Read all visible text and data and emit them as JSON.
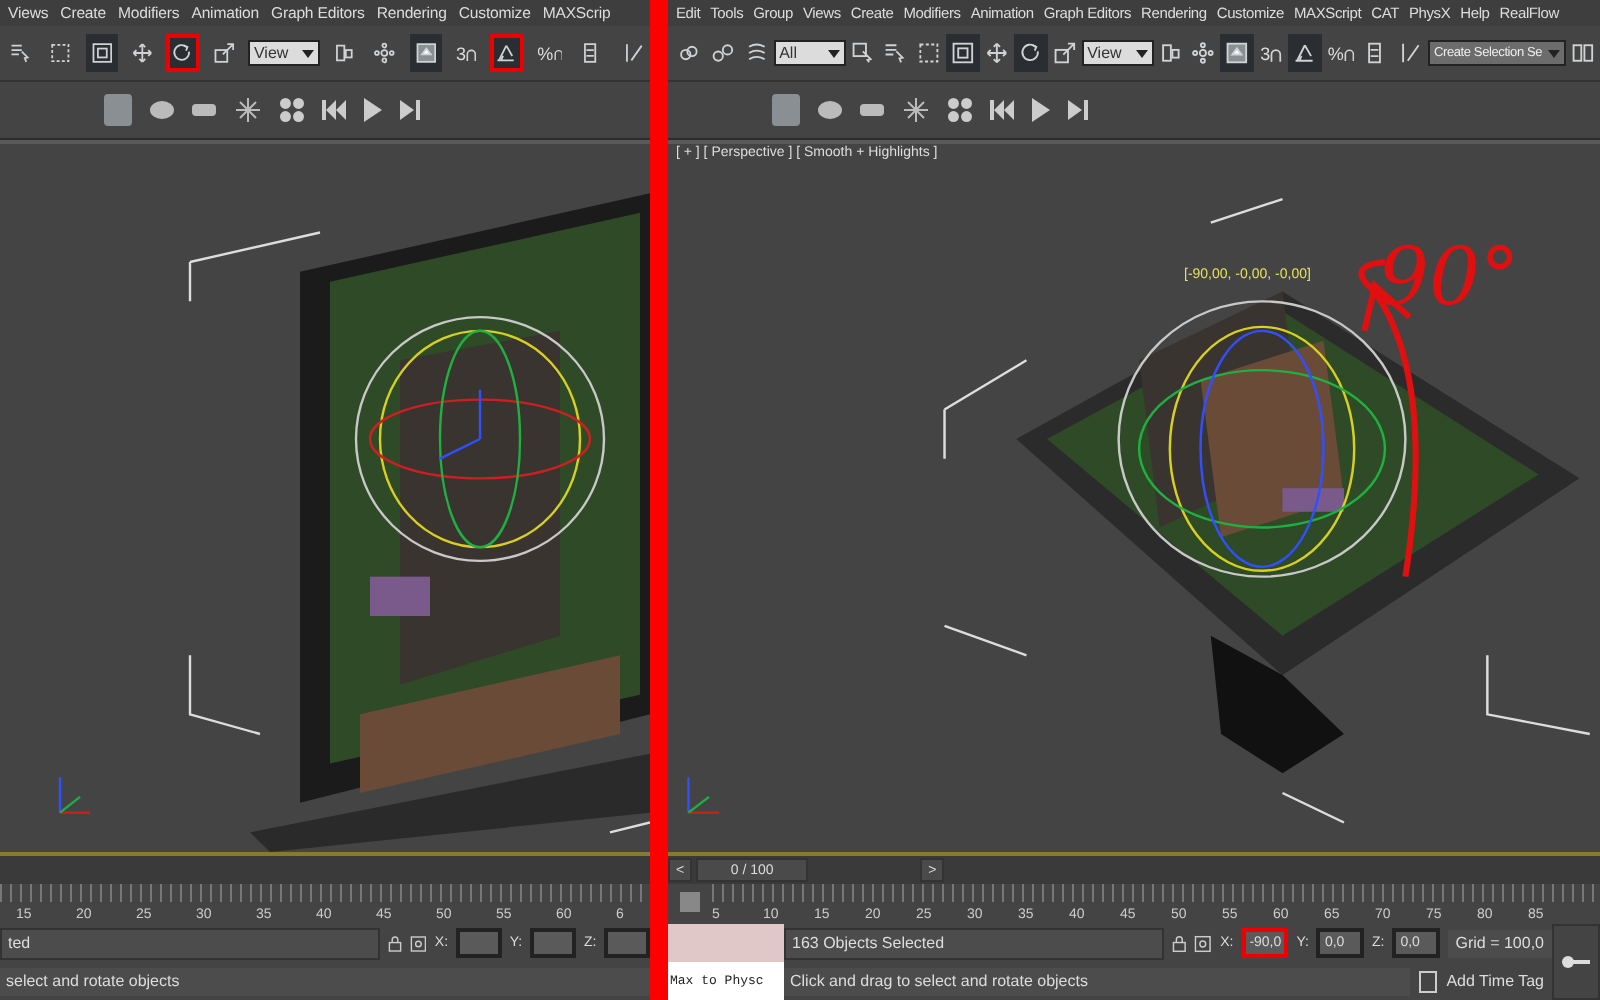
{
  "panels": [
    {
      "menu": [
        "Views",
        "Create",
        "Modifiers",
        "Animation",
        "Graph Editors",
        "Rendering",
        "Customize",
        "MAXScrip"
      ],
      "tools": [
        {
          "kind": "select-by-name",
          "circled": false,
          "selected": false
        },
        {
          "kind": "rect-region",
          "circled": false,
          "selected": false
        },
        {
          "kind": "window-crossing",
          "circled": false,
          "selected": true
        },
        {
          "kind": "move",
          "circled": false,
          "selected": false
        },
        {
          "kind": "rotate",
          "circled": true,
          "selected": true
        },
        {
          "kind": "scale",
          "circled": false,
          "selected": false
        },
        {
          "kind": "dropdown",
          "value": "View"
        },
        {
          "kind": "pivot",
          "circled": false,
          "selected": false
        },
        {
          "kind": "pivot-node",
          "circled": false,
          "selected": false
        },
        {
          "kind": "manipulate",
          "circled": false,
          "selected": true
        },
        {
          "kind": "snap",
          "label": "3",
          "circled": false,
          "selected": false
        },
        {
          "kind": "angle-snap",
          "circled": true,
          "selected": true
        },
        {
          "kind": "percent-snap",
          "label": "%",
          "circled": false,
          "selected": false
        },
        {
          "kind": "spinner-snap",
          "circled": false,
          "selected": false
        },
        {
          "kind": "edit-named",
          "circled": false,
          "selected": false
        }
      ],
      "ruler": [
        "15",
        "20",
        "25",
        "30",
        "35",
        "40",
        "45",
        "50",
        "55",
        "60",
        "6"
      ],
      "status": "ted",
      "coords": [
        {
          "label": "X:",
          "circled": false
        },
        {
          "label": "Y:",
          "circled": false
        },
        {
          "label": "Z:",
          "circled": false
        }
      ],
      "prompt": "select and rotate objects"
    },
    {
      "menu": [
        "Edit",
        "Tools",
        "Group",
        "Views",
        "Create",
        "Modifiers",
        "Animation",
        "Graph Editors",
        "Rendering",
        "Customize",
        "MAXScript",
        "CAT",
        "PhysX",
        "Help",
        "RealFlow"
      ],
      "tools": [
        {
          "kind": "link",
          "circled": false,
          "selected": false
        },
        {
          "kind": "unlink",
          "circled": false,
          "selected": false
        },
        {
          "kind": "bind",
          "circled": false,
          "selected": false
        },
        {
          "kind": "dropdown",
          "value": "All"
        },
        {
          "kind": "select",
          "circled": false,
          "selected": false
        },
        {
          "kind": "select-by-name",
          "circled": false,
          "selected": false
        },
        {
          "kind": "rect-region",
          "circled": false,
          "selected": false
        },
        {
          "kind": "window-crossing",
          "circled": false,
          "selected": true
        },
        {
          "kind": "move",
          "circled": false,
          "selected": false
        },
        {
          "kind": "rotate",
          "circled": false,
          "selected": true
        },
        {
          "kind": "scale",
          "circled": false,
          "selected": false
        },
        {
          "kind": "dropdown",
          "value": "View"
        },
        {
          "kind": "pivot",
          "circled": false,
          "selected": false
        },
        {
          "kind": "pivot-node",
          "circled": false,
          "selected": false
        },
        {
          "kind": "manipulate",
          "circled": false,
          "selected": true
        },
        {
          "kind": "snap",
          "label": "3",
          "circled": false,
          "selected": false
        },
        {
          "kind": "angle-snap",
          "circled": false,
          "selected": true
        },
        {
          "kind": "percent-snap",
          "label": "%",
          "circled": false,
          "selected": false
        },
        {
          "kind": "spinner-snap",
          "circled": false,
          "selected": false
        },
        {
          "kind": "edit-named",
          "circled": false,
          "selected": false
        },
        {
          "kind": "wide-dropdown",
          "value": "Create Selection Se"
        },
        {
          "kind": "mirror",
          "circled": false,
          "selected": false
        }
      ],
      "viewport_label": "[ + ] [ Perspective ] [ Smooth + Highlights ]",
      "gizmo_readout": "[-90,00, -0,00, -0,00]",
      "handwritten_note": "90°",
      "time_slider": {
        "prev": "<",
        "position": "0 / 100",
        "level": 0,
        "next": ">"
      },
      "ruler": [
        "5",
        "10",
        "15",
        "20",
        "25",
        "30",
        "35",
        "40",
        "45",
        "50",
        "55",
        "60",
        "65",
        "70",
        "75",
        "80",
        "85"
      ],
      "listener": "Max to Physc",
      "status": "163 Objects Selected",
      "coords": [
        {
          "label": "X:",
          "value": "-90,0",
          "circled": true
        },
        {
          "label": "Y:",
          "value": "0,0",
          "circled": false
        },
        {
          "label": "Z:",
          "value": "0,0",
          "circled": false
        }
      ],
      "grid": "Grid = 100,0",
      "prompt": "Click and drag to select and rotate objects",
      "time_tag": "Add Time Tag"
    }
  ]
}
